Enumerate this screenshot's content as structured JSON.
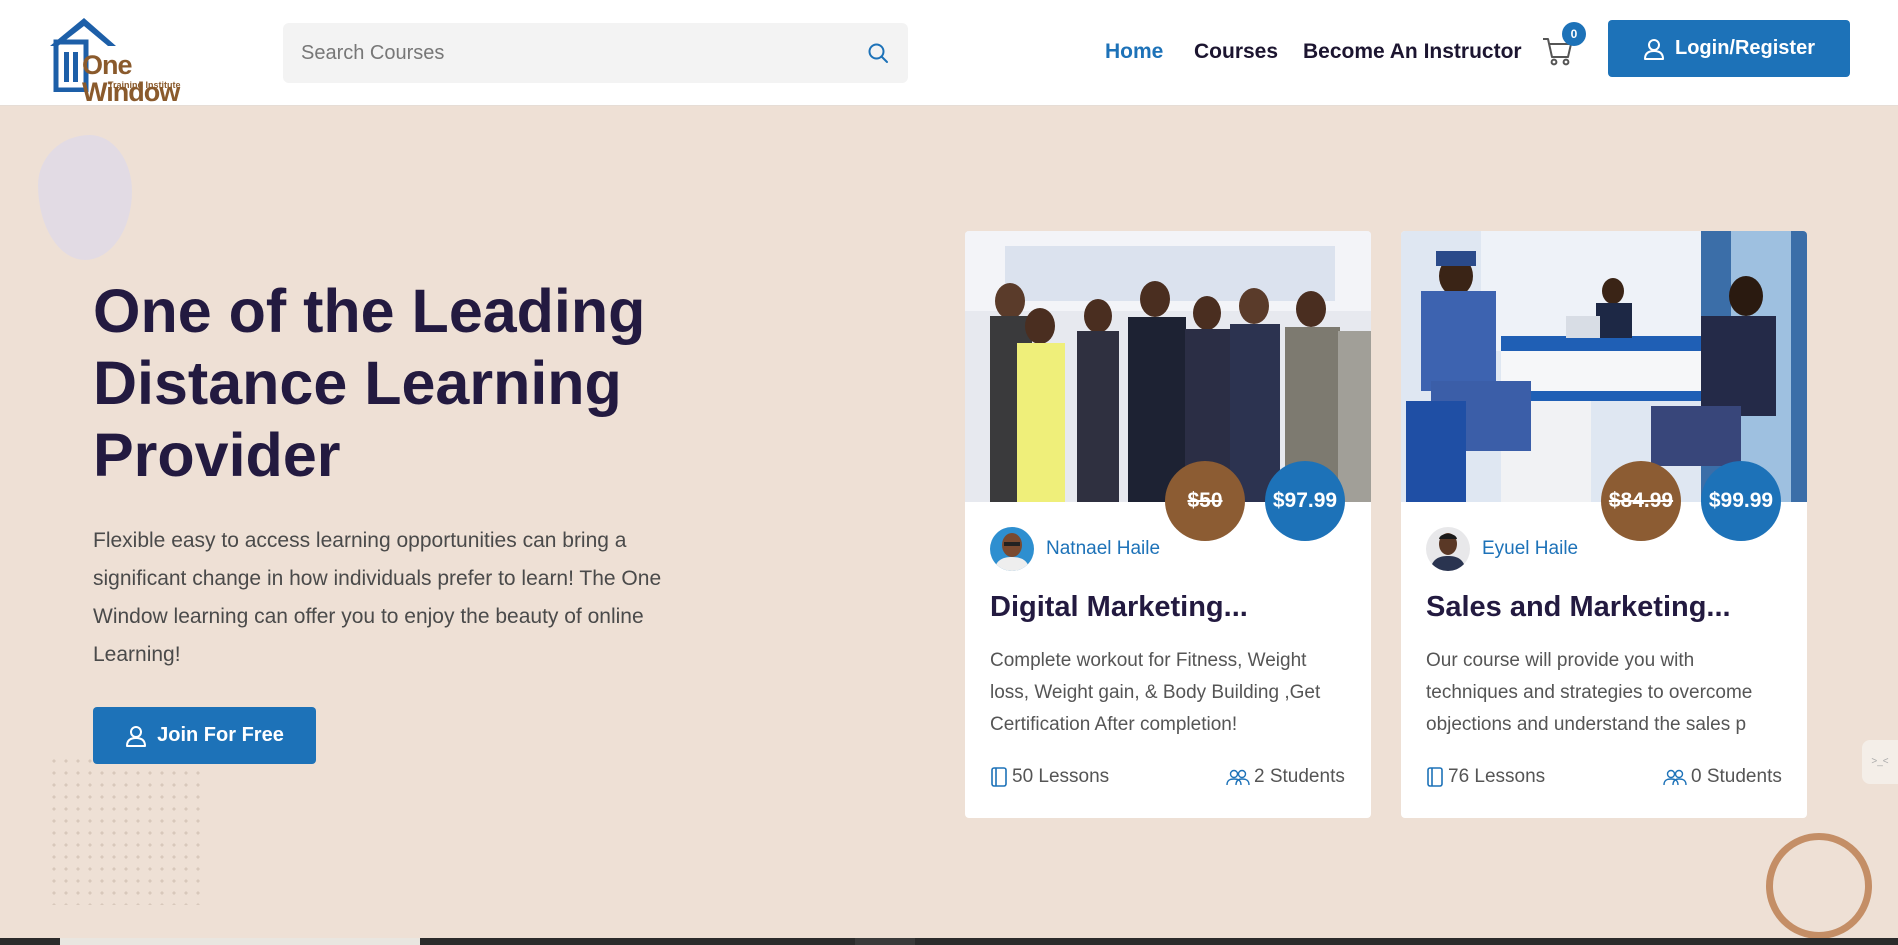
{
  "header": {
    "logo_text": "One Window",
    "logo_subtext": "Training Institute",
    "search_placeholder": "Search Courses",
    "nav": [
      "Home",
      "Courses",
      "Become An Instructor"
    ],
    "cart_count": "0",
    "login_label": "Login/Register"
  },
  "hero": {
    "title": "One of the Leading Distance Learning Provider",
    "description": "Flexible easy to access learning opportunities can bring a significant change in how individuals prefer to learn! The One Window learning can offer you to enjoy the beauty of online Learning!",
    "join_label": "Join For Free"
  },
  "courses": [
    {
      "old_price": "$50",
      "new_price": "$97.99",
      "instructor": "Natnael Haile",
      "title": "Digital Marketing...",
      "description": "Complete workout for Fitness, Weight loss, Weight gain, & Body Building ,Get Certification After completion!",
      "lessons": "50 Lessons",
      "students": "2 Students"
    },
    {
      "old_price": "$84.99",
      "new_price": "$99.99",
      "instructor": "Eyuel Haile",
      "title": "Sales and Marketing...",
      "description": "Our course will provide you with techniques and strategies to overcome objections and understand the sales p",
      "lessons": "76 Lessons",
      "students": "0 Students"
    }
  ],
  "colors": {
    "primary": "#1d72b8",
    "brown": "#8c5c33",
    "background": "#eee0d5",
    "heading": "#231a40"
  }
}
